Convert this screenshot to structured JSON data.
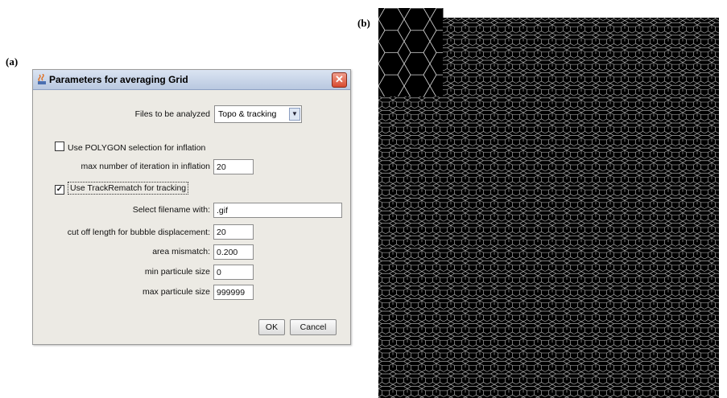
{
  "panels": {
    "a": "(a)",
    "b": "(b)"
  },
  "dialog": {
    "title": "Parameters for averaging Grid",
    "close_glyph": "✕",
    "files_label": "Files to be analyzed",
    "files_value": "Topo & tracking",
    "polygon_checkbox": {
      "label": "Use POLYGON selection for inflation",
      "checked": false
    },
    "max_iter_label": "max number of iteration in inflation",
    "max_iter_value": "20",
    "trackrematch_checkbox": {
      "label": "Use TrackRematch for tracking",
      "checked": true
    },
    "filename_label": "Select filename with:",
    "filename_value": ".gif",
    "cutoff_label": "cut off length for bubble displacement:",
    "cutoff_value": "20",
    "area_label": "area mismatch:",
    "area_value": "0.200",
    "min_size_label": "min particule size",
    "min_size_value": "0",
    "max_size_label": "max particule size",
    "max_size_value": "999999",
    "ok_label": "OK",
    "cancel_label": "Cancel"
  },
  "icons": {
    "title": "java-coffee-icon",
    "close": "close-icon",
    "dropdown": "chevron-down-icon",
    "check": "checkmark-icon"
  },
  "colors": {
    "mesh_background": "#000000",
    "mesh_lines": "#d8d8d8",
    "close_button": "#d84a30"
  }
}
